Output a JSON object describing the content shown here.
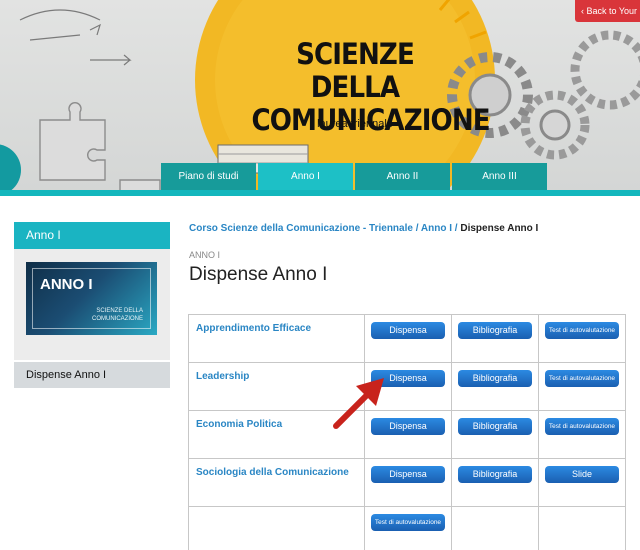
{
  "header": {
    "title_line1": "SCIENZE DELLA",
    "title_line2": "COMUNICAZIONE",
    "subtitle": "laurea triennale",
    "back_label": "‹ Back to Your"
  },
  "tabs": [
    {
      "label": "Piano di studi",
      "active": false
    },
    {
      "label": "Anno I",
      "active": true
    },
    {
      "label": "Anno II",
      "active": false
    },
    {
      "label": "Anno III",
      "active": false
    }
  ],
  "sidebar": {
    "heading": "Anno I",
    "thumb_title": "ANNO I",
    "thumb_subtitle": "SCIENZE DELLA COMUNICAZIONE",
    "item": "Dispense Anno I"
  },
  "breadcrumb": {
    "path": "Corso Scienze della Comunicazione - Triennale / Anno I /",
    "current": "Dispense Anno I"
  },
  "page": {
    "eyebrow": "ANNO I",
    "title": "Dispense Anno I"
  },
  "table": {
    "rows": [
      {
        "subject": "Apprendimento Efficace",
        "b1": "Dispensa",
        "b2": "Bibliografia",
        "b3": "Test di autovalutazione"
      },
      {
        "subject": "Leadership",
        "b1": "Dispensa",
        "b2": "Bibliografia",
        "b3": "Test di autovalutazione"
      },
      {
        "subject": "Economia Politica",
        "b1": "Dispensa",
        "b2": "Bibliografia",
        "b3": "Test di autovalutazione"
      },
      {
        "subject": "Sociologia della Comunicazione",
        "b1": "Dispensa",
        "b2": "Bibliografia",
        "b3": "Slide"
      },
      {
        "subject": "",
        "b1": "Test di autovalutazione",
        "b2": "",
        "b3": ""
      }
    ]
  },
  "colors": {
    "teal": "#14b7bd",
    "tab": "#179b9a",
    "link_blue": "#2a86c4",
    "button_blue": "#1f6fc9",
    "arrow_red": "#c8231c"
  }
}
